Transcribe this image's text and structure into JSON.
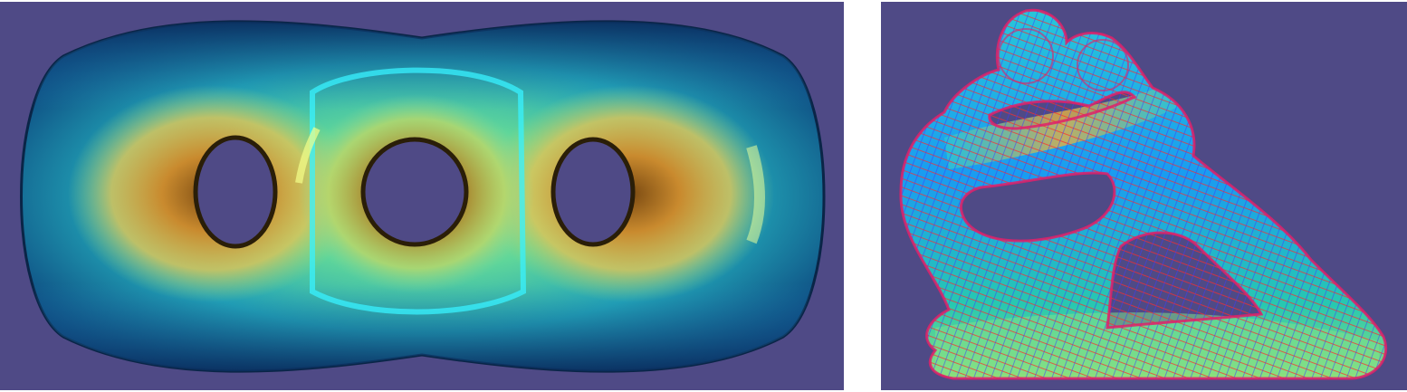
{
  "figure": {
    "background_color": "#ffffff",
    "viewport_color": "#4f4a86",
    "panels": [
      {
        "id": "left",
        "content": "three-hole-torus-surface",
        "colormap": [
          "#0b3f7a",
          "#1f86b8",
          "#20c6a8",
          "#b5e35f",
          "#d9a23a",
          "#7a4a12"
        ],
        "highlight_color": "#38f2ff"
      },
      {
        "id": "right",
        "content": "fertility-sculpture-mesh-with-cross-field",
        "colormap": [
          "#1aa6ff",
          "#28d0c4",
          "#7fe08a",
          "#e4a23a"
        ],
        "cross_field_colors": [
          "#ff2a2a",
          "#3a3aff"
        ]
      }
    ]
  }
}
